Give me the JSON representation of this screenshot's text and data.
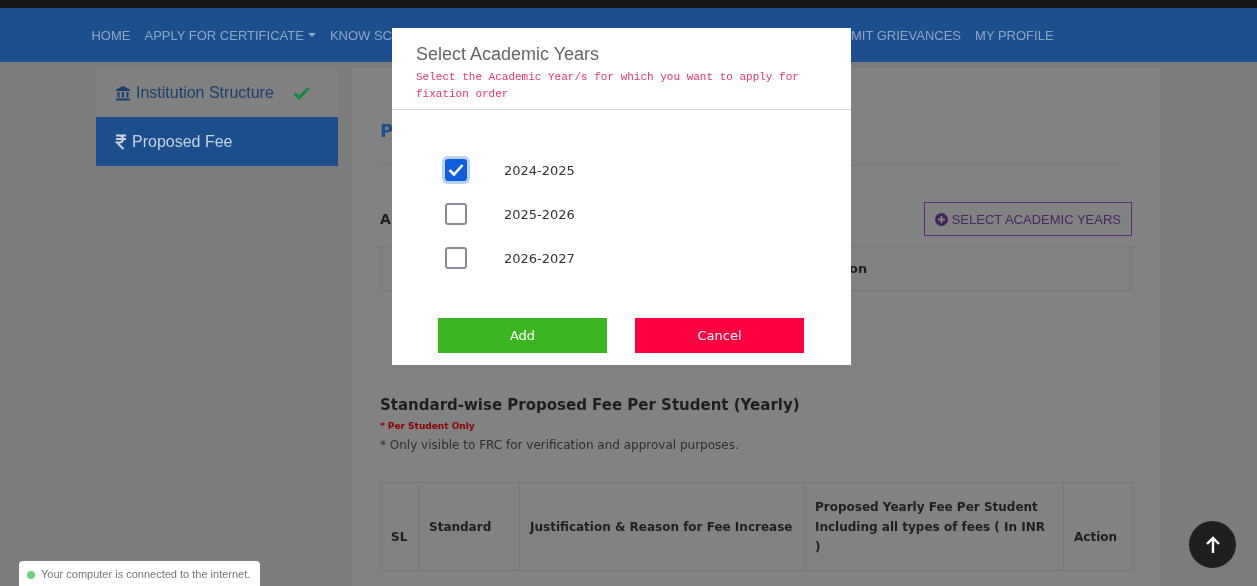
{
  "nav": {
    "items": [
      {
        "label": "HOME",
        "dropdown": false
      },
      {
        "label": "APPLY FOR CERTIFICATE",
        "dropdown": true
      },
      {
        "label": "KNOW SC",
        "dropdown": false
      },
      {
        "label": "MIT GRIEVANCES",
        "dropdown": false
      },
      {
        "label": "MY PROFILE",
        "dropdown": false
      }
    ]
  },
  "sidebar": {
    "items": [
      {
        "label": "Institution Structure",
        "completed": true,
        "selected": false
      },
      {
        "label": "Proposed Fee",
        "completed": false,
        "selected": true
      }
    ]
  },
  "content": {
    "heading": "P",
    "section_label": "A",
    "select_button": "SELECT ACADEMIC YEARS",
    "table_1": {
      "columns": [
        "on"
      ]
    },
    "fee_section": {
      "title": "Standard-wise Proposed Fee Per Student (Yearly)",
      "note_required": "* Per Student Only",
      "note": "* Only visible to FRC for verification and approval purposes.",
      "columns": [
        "SL",
        "Standard",
        "Justification & Reason for Fee Increase",
        "Proposed Yearly Fee Per Student Including all types of fees ( In INR )",
        "Action"
      ]
    }
  },
  "modal": {
    "title": "Select Academic Years",
    "subtitle": "Select the Academic Year/s for which you want to apply for fixation order",
    "years": [
      {
        "label": "2024-2025",
        "checked": true
      },
      {
        "label": "2025-2026",
        "checked": false
      },
      {
        "label": "2026-2027",
        "checked": false
      }
    ],
    "buttons": [
      {
        "label": "Add",
        "kind": "confirm"
      },
      {
        "label": "Cancel",
        "kind": "cancel"
      }
    ]
  },
  "toast": {
    "text": "Your computer is connected to the internet.",
    "online": true
  }
}
